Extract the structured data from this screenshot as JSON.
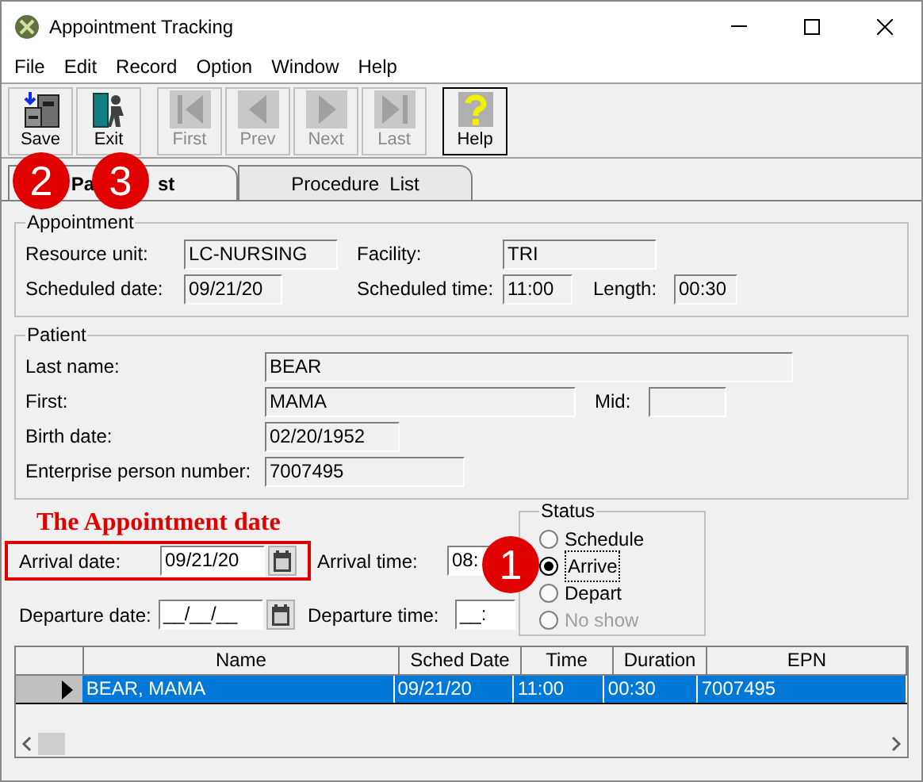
{
  "window": {
    "title": "Appointment Tracking"
  },
  "menu": [
    "File",
    "Edit",
    "Record",
    "Option",
    "Window",
    "Help"
  ],
  "toolbar": [
    {
      "label": "Save",
      "kind": "save",
      "disabled": false
    },
    {
      "label": "Exit",
      "kind": "exit",
      "disabled": false
    },
    {
      "label": "First",
      "kind": "first",
      "disabled": true
    },
    {
      "label": "Prev",
      "kind": "prev",
      "disabled": true
    },
    {
      "label": "Next",
      "kind": "next",
      "disabled": true
    },
    {
      "label": "Last",
      "kind": "last",
      "disabled": true
    },
    {
      "label": "Help",
      "kind": "help",
      "disabled": false
    }
  ],
  "tabs": [
    {
      "label_parts": [
        "Pa",
        "st"
      ],
      "selected": true
    },
    {
      "label_parts": [
        "Procedure  List"
      ],
      "selected": false
    }
  ],
  "appointment": {
    "title": "Appointment",
    "resource_unit": {
      "label": "Resource unit:",
      "value": "LC-NURSING"
    },
    "facility": {
      "label": "Facility:",
      "value": "TRI"
    },
    "scheduled_date": {
      "label": "Scheduled date:",
      "value": "09/21/20"
    },
    "scheduled_time": {
      "label": "Scheduled time:",
      "value": "11:00"
    },
    "length": {
      "label": "Length:",
      "value": "00:30"
    }
  },
  "patient": {
    "title": "Patient",
    "last_name": {
      "label": "Last name:",
      "value": "BEAR"
    },
    "first": {
      "label": "First:",
      "value": "MAMA"
    },
    "mid": {
      "label": "Mid:"
    },
    "birth_date": {
      "label": "Birth date:",
      "value": "02/20/1952"
    },
    "epn": {
      "label": "Enterprise person number:",
      "value": "7007495"
    }
  },
  "annotation": "The Appointment date",
  "arrival_date": {
    "label": "Arrival date:",
    "value": "09/21/20"
  },
  "arrival_time": {
    "label": "Arrival time:",
    "value": "08:"
  },
  "departure_date": {
    "label": "Departure date:",
    "value": "__/__/__"
  },
  "departure_time": {
    "label": "Departure time:",
    "value": "__:"
  },
  "status": {
    "title": "Status",
    "options": [
      {
        "label": "Schedule",
        "selected": false,
        "disabled": false
      },
      {
        "label": "Arrive",
        "selected": true,
        "disabled": false
      },
      {
        "label": "Depart",
        "selected": false,
        "disabled": false
      },
      {
        "label": "No show",
        "selected": false,
        "disabled": true
      }
    ]
  },
  "table": {
    "columns": [
      "Name",
      "Sched Date",
      "Time",
      "Duration",
      "EPN"
    ],
    "rows": [
      {
        "cells": [
          "BEAR, MAMA",
          "09/21/20",
          "11:00",
          "00:30",
          "7007495"
        ],
        "selected": true
      }
    ]
  },
  "callouts": [
    "2",
    "3",
    "1"
  ]
}
